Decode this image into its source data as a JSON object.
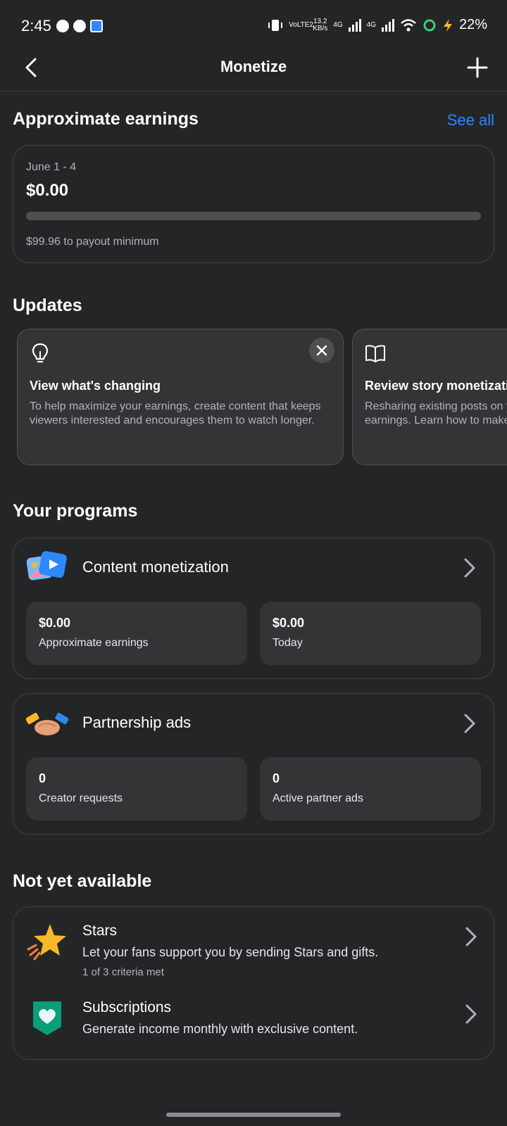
{
  "status_bar": {
    "time": "2:45",
    "speed_value": "13.2",
    "speed_unit": "KB/s",
    "volte": "VoLTE2",
    "net1": "4G",
    "net2": "4G",
    "battery": "22%"
  },
  "header": {
    "title": "Monetize",
    "back_icon": "chevron-left-icon",
    "add_icon": "plus-icon"
  },
  "earnings": {
    "section_title": "Approximate earnings",
    "see_all": "See all",
    "date_range": "June 1 - 4",
    "amount": "$0.00",
    "progress_fraction": 0.0,
    "payout_note": "$99.96 to payout minimum"
  },
  "updates": {
    "section_title": "Updates",
    "cards": [
      {
        "icon": "lightbulb-icon",
        "title": "View what's changing",
        "body_line1": "To help maximize your earnings, create content that keeps",
        "body_line2": "viewers interested and encourages them to watch longer."
      },
      {
        "icon": "book-icon",
        "title": "Review story monetization",
        "body_line1": "Resharing existing posts on your story won't count toward",
        "body_line2": "earnings. Learn how to make the most of your stories."
      }
    ]
  },
  "programs": {
    "section_title": "Your programs",
    "items": [
      {
        "name": "Content monetization",
        "icon": "photo-video-icon",
        "stats": [
          {
            "value": "$0.00",
            "label": "Approximate earnings"
          },
          {
            "value": "$0.00",
            "label": "Today"
          }
        ]
      },
      {
        "name": "Partnership ads",
        "icon": "handshake-icon",
        "stats": [
          {
            "value": "0",
            "label": "Creator requests"
          },
          {
            "value": "0",
            "label": "Active partner ads"
          }
        ]
      }
    ]
  },
  "not_available": {
    "section_title": "Not yet available",
    "items": [
      {
        "title": "Stars",
        "icon": "star-icon",
        "description": "Let your fans support you by sending Stars and gifts.",
        "subtext": "1 of 3 criteria met"
      },
      {
        "title": "Subscriptions",
        "icon": "heart-badge-icon",
        "description": "Generate income monthly with exclusive content."
      }
    ]
  },
  "colors": {
    "background": "#242526",
    "card_fill": "#333436",
    "accent": "#2d88ff",
    "text_primary": "#ffffff",
    "text_secondary": "#b0b3b8"
  }
}
